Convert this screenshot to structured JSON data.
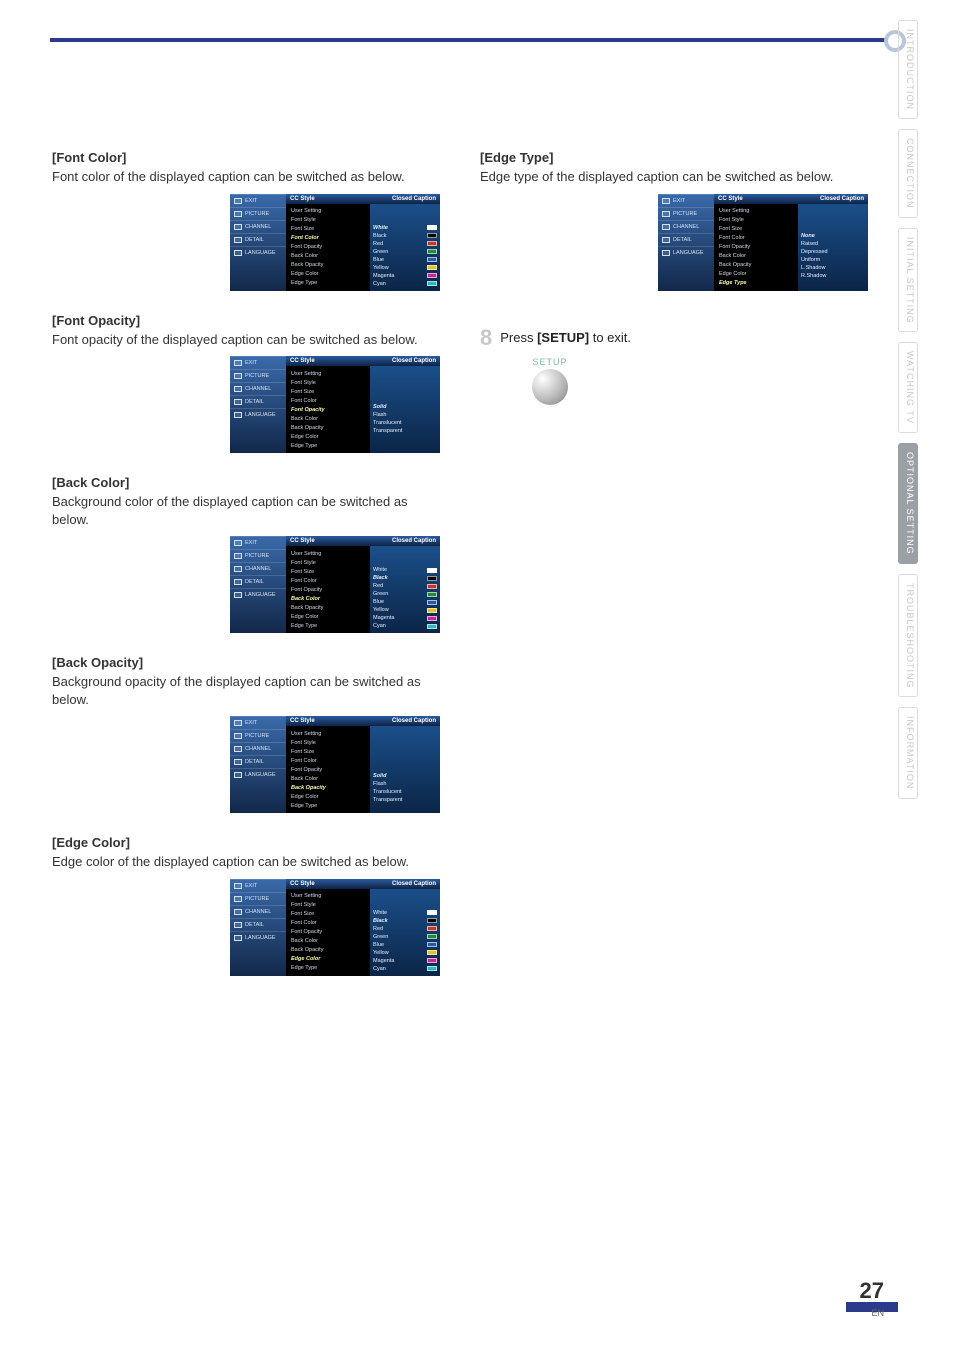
{
  "page": {
    "number": "27",
    "lang": "EN"
  },
  "side_tabs": [
    "INTRODUCTION",
    "CONNECTION",
    "INITIAL SETTING",
    "WATCHING TV",
    "OPTIONAL SETTING",
    "TROUBLESHOOTING",
    "INFORMATION"
  ],
  "side_tabs_active_index": 4,
  "osd_nav": [
    "EXIT",
    "PICTURE",
    "CHANNEL",
    "DETAIL",
    "LANGUAGE"
  ],
  "osd_header": {
    "left": "CC Style",
    "right": "Closed Caption"
  },
  "osd_items": [
    "User Setting",
    "Font Style",
    "Font Size",
    "Font Color",
    "Font Opacity",
    "Back Color",
    "Back Opacity",
    "Edge Color",
    "Edge Type"
  ],
  "colors": {
    "white": "#ffffff",
    "black": "#000000",
    "red": "#c0392b",
    "green": "#1f8b3b",
    "blue": "#2b5aa6",
    "yellow": "#e2c12b",
    "magenta": "#c02b9c",
    "cyan": "#2bb7c0"
  },
  "sections": [
    {
      "id": "font-color",
      "title": "[Font Color]",
      "desc": "Font color of the displayed caption can be switched as below.",
      "highlight": "Font Color",
      "values_kind": "colors",
      "values": [
        {
          "label": "White",
          "swatch": "white",
          "hi": true
        },
        {
          "label": "Black",
          "swatch": "black"
        },
        {
          "label": "Red",
          "swatch": "red"
        },
        {
          "label": "Green",
          "swatch": "green"
        },
        {
          "label": "Blue",
          "swatch": "blue"
        },
        {
          "label": "Yellow",
          "swatch": "yellow"
        },
        {
          "label": "Magenta",
          "swatch": "magenta"
        },
        {
          "label": "Cyan",
          "swatch": "cyan"
        }
      ],
      "values_offset": 2
    },
    {
      "id": "font-opacity",
      "title": "[Font Opacity]",
      "desc": "Font opacity of the displayed caption can be switched as below.",
      "highlight": "Font Opacity",
      "values_kind": "text",
      "values": [
        {
          "label": "Solid",
          "hi": true
        },
        {
          "label": "Flash"
        },
        {
          "label": "Translucent"
        },
        {
          "label": "Transparent"
        }
      ],
      "values_offset": 4
    },
    {
      "id": "back-color",
      "title": "[Back Color]",
      "desc": "Background color of the displayed caption can be switched as below.",
      "highlight": "Back Color",
      "values_kind": "colors",
      "values": [
        {
          "label": "White",
          "swatch": "white"
        },
        {
          "label": "Black",
          "swatch": "black",
          "hi": true
        },
        {
          "label": "Red",
          "swatch": "red"
        },
        {
          "label": "Green",
          "swatch": "green"
        },
        {
          "label": "Blue",
          "swatch": "blue"
        },
        {
          "label": "Yellow",
          "swatch": "yellow"
        },
        {
          "label": "Magenta",
          "swatch": "magenta"
        },
        {
          "label": "Cyan",
          "swatch": "cyan"
        }
      ],
      "values_offset": 2
    },
    {
      "id": "back-opacity",
      "title": "[Back Opacity]",
      "desc": "Background opacity of the displayed caption can be switched as below.",
      "highlight": "Back Opacity",
      "values_kind": "text",
      "values": [
        {
          "label": "Solid",
          "hi": true
        },
        {
          "label": "Flash"
        },
        {
          "label": "Translucent"
        },
        {
          "label": "Transparent"
        }
      ],
      "values_offset": 5
    },
    {
      "id": "edge-color",
      "title": "[Edge Color]",
      "desc": "Edge color of the displayed caption can be switched as below.",
      "highlight": "Edge Color",
      "values_kind": "colors",
      "values": [
        {
          "label": "White",
          "swatch": "white"
        },
        {
          "label": "Black",
          "swatch": "black",
          "hi": true
        },
        {
          "label": "Red",
          "swatch": "red"
        },
        {
          "label": "Green",
          "swatch": "green"
        },
        {
          "label": "Blue",
          "swatch": "blue"
        },
        {
          "label": "Yellow",
          "swatch": "yellow"
        },
        {
          "label": "Magenta",
          "swatch": "magenta"
        },
        {
          "label": "Cyan",
          "swatch": "cyan"
        }
      ],
      "values_offset": 2
    },
    {
      "id": "edge-type",
      "title": "[Edge Type]",
      "desc": "Edge type of the displayed caption can be switched as below.",
      "highlight": "Edge Type",
      "values_kind": "text",
      "values": [
        {
          "label": "None",
          "hi": true
        },
        {
          "label": "Raised"
        },
        {
          "label": "Depressed"
        },
        {
          "label": "Uniform"
        },
        {
          "label": "L.Shadow"
        },
        {
          "label": "R.Shadow"
        }
      ],
      "values_offset": 3
    }
  ],
  "step8": {
    "number": "8",
    "text_prefix": "Press ",
    "text_bold": "[SETUP]",
    "text_suffix": " to exit.",
    "button_label": "SETUP"
  }
}
